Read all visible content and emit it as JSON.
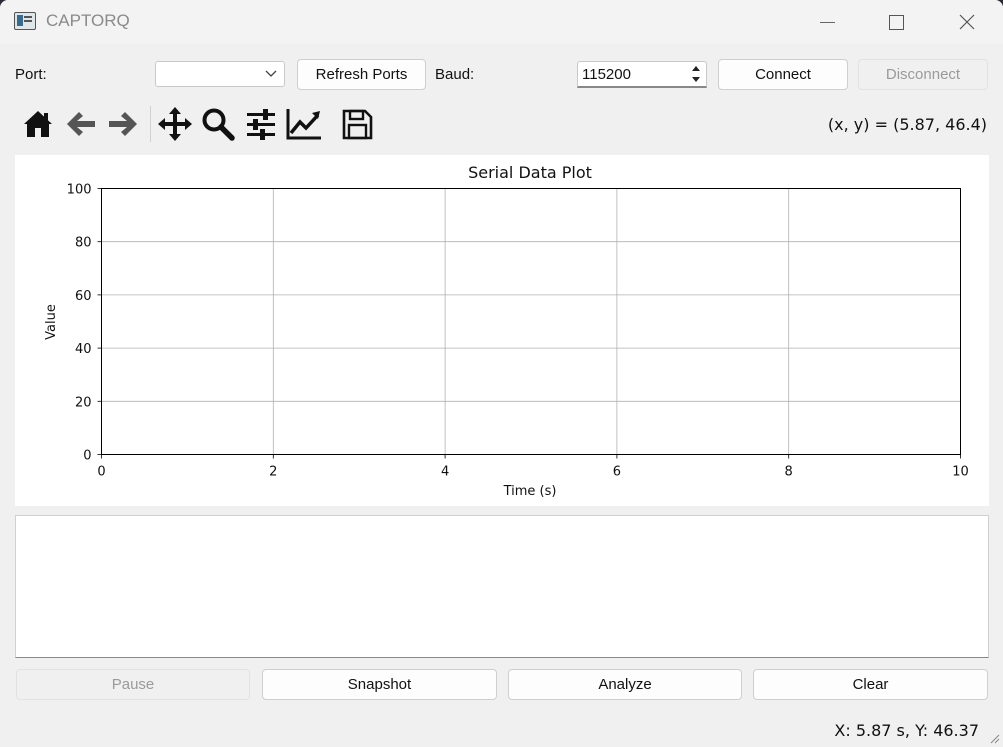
{
  "window": {
    "title": "CAPTORQ"
  },
  "controls": {
    "port_label": "Port:",
    "port_value": "",
    "refresh_label": "Refresh Ports",
    "baud_label": "Baud:",
    "baud_value": "115200",
    "connect_label": "Connect",
    "disconnect_label": "Disconnect"
  },
  "toolbar": {
    "icons": [
      "home-icon",
      "back-arrow-icon",
      "forward-arrow-icon",
      "pan-icon",
      "zoom-icon",
      "configure-subplots-icon",
      "edit-axis-icon",
      "save-icon"
    ],
    "coords_readout": "(x, y) = (5.87, 46.4)"
  },
  "chart_data": {
    "type": "line",
    "title": "Serial Data Plot",
    "xlabel": "Time (s)",
    "ylabel": "Value",
    "xlim": [
      0,
      10
    ],
    "ylim": [
      0,
      100
    ],
    "x_ticks": [
      0,
      2,
      4,
      6,
      8,
      10
    ],
    "y_ticks": [
      0,
      20,
      40,
      60,
      80,
      100
    ],
    "grid": true,
    "series": []
  },
  "log": {
    "text": ""
  },
  "buttons": {
    "pause_label": "Pause",
    "snapshot_label": "Snapshot",
    "analyze_label": "Analyze",
    "clear_label": "Clear"
  },
  "statusbar": {
    "text": "X: 5.87 s, Y: 46.37"
  },
  "colors": {
    "window_bg": "#f0f0f0",
    "plot_bg": "#ffffff",
    "grid": "#b0b0b0",
    "disabled_text": "#9a9a9a"
  }
}
